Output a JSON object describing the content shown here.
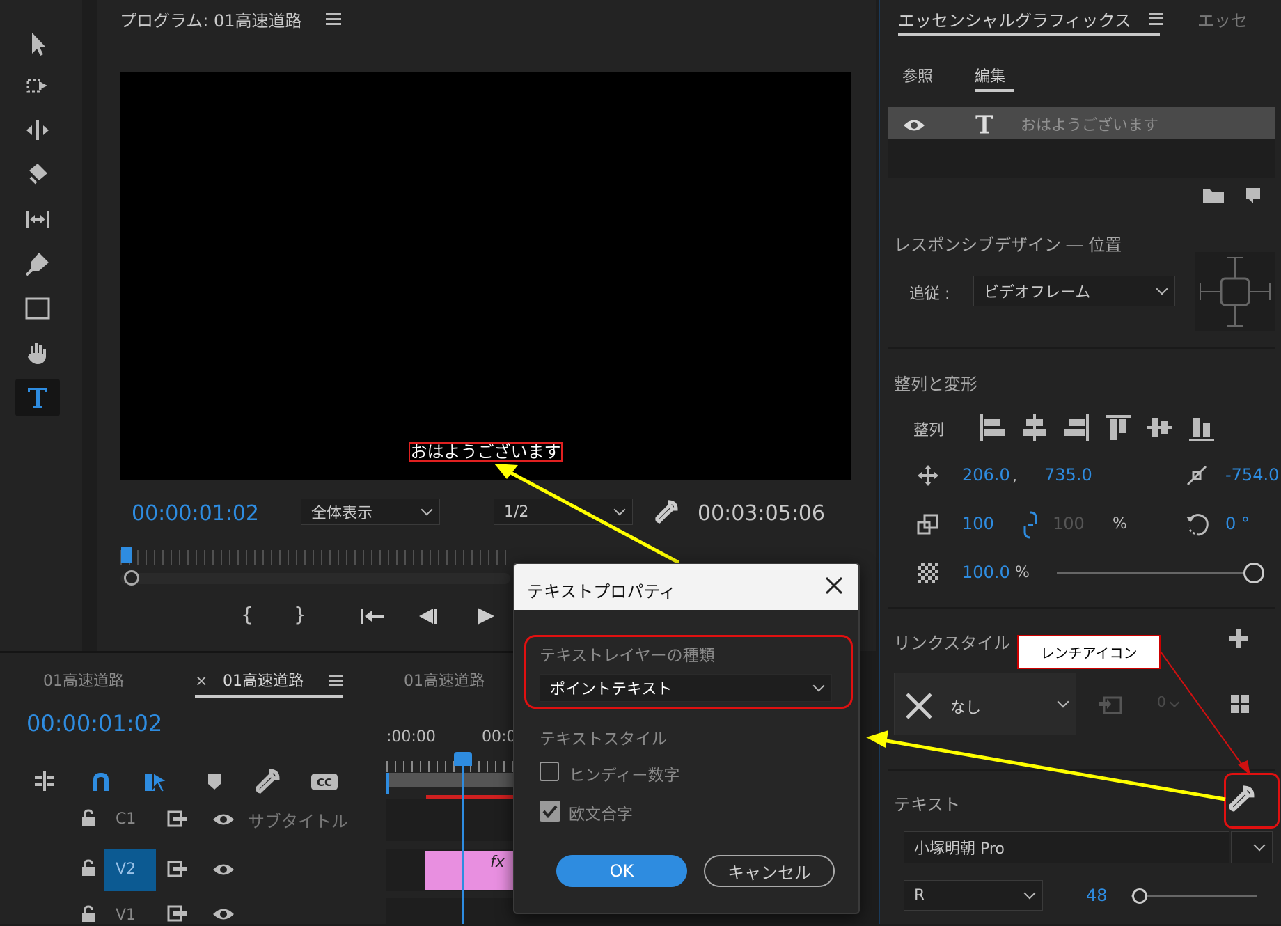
{
  "program": {
    "title": "プログラム: 01高速道路",
    "caption_text": "おはようございます",
    "timecode": "00:00:01:02",
    "zoom_select": "全体表示",
    "resolution_select": "1/2",
    "duration": "00:03:05:06"
  },
  "timeline": {
    "tabs": [
      "01高速道路",
      "01高速道路",
      "01高速道路"
    ],
    "close_glyph": "×",
    "timecode": "00:00:01:02",
    "ruler_labels": [
      ":00:00",
      "00:0"
    ],
    "tracks": [
      {
        "id": "C1",
        "name": "サブタイトル"
      },
      {
        "id": "V2",
        "name": ""
      },
      {
        "id": "V1",
        "name": ""
      }
    ],
    "clip_fx": "fx"
  },
  "essential": {
    "title": "エッセンシャルグラフィックス",
    "title2": "エッセ",
    "tab_browse": "参照",
    "tab_edit": "編集",
    "layer_name": "おはようございます",
    "responsive_title": "レスポンシブデザイン ― 位置",
    "follow_label": "追従 :",
    "follow_value": "ビデオフレーム",
    "align_title": "整列と変形",
    "align_label": "整列",
    "pos_x": "206.0",
    "pos_comma": ",",
    "pos_y": "735.0",
    "anchor": "-754.0",
    "scale": "100",
    "scale2": "100",
    "percent": "%",
    "rotation": "0 °",
    "opacity": "100.0",
    "opacity_pct": "%",
    "link_style_title": "リンクスタイル",
    "style_value": "なし",
    "style_count": "0",
    "text_title": "テキスト",
    "font": "小塚明朝 Pro",
    "font_style": "R",
    "font_size": "48"
  },
  "dialog": {
    "title": "テキストプロパティ",
    "layer_type_label": "テキストレイヤーの種類",
    "layer_type_value": "ポイントテキスト",
    "text_style_label": "テキストスタイル",
    "hindi_digits": "ヒンディー数字",
    "ligatures": "欧文合字",
    "ok": "OK",
    "cancel": "キャンセル",
    "ligatures_checked": true,
    "hindi_checked": false
  },
  "annotation": {
    "label": "レンチアイコン"
  },
  "colors": {
    "accent_blue": "#2e8ce0",
    "annotation_red": "#e01010",
    "arrow_yellow": "#ffff00",
    "clip_pink": "#e88fe0"
  }
}
